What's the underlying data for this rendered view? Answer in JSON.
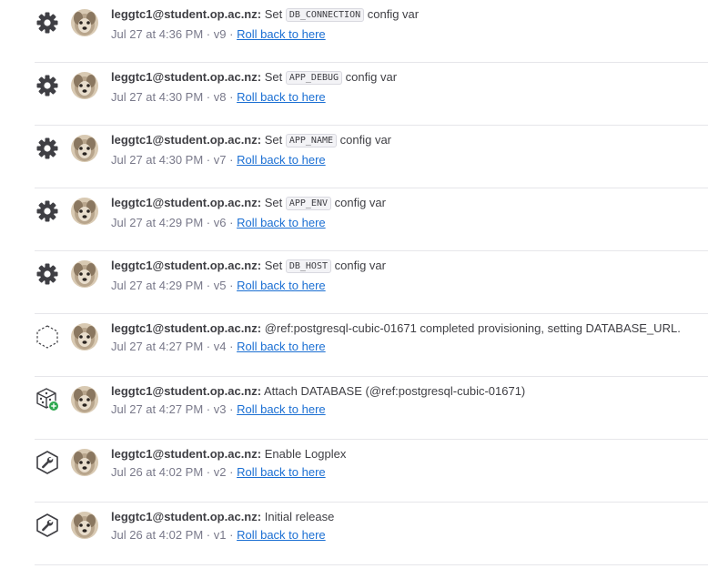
{
  "activity": [
    {
      "icon": "gear-icon",
      "user": "leggtc1@student.op.ac.nz:",
      "pre": "Set",
      "code": "DB_CONNECTION",
      "post": "config var",
      "time": "Jul 27 at 4:36 PM",
      "version": "v9",
      "rollback": "Roll back to here"
    },
    {
      "icon": "gear-icon",
      "user": "leggtc1@student.op.ac.nz:",
      "pre": "Set",
      "code": "APP_DEBUG",
      "post": "config var",
      "time": "Jul 27 at 4:30 PM",
      "version": "v8",
      "rollback": "Roll back to here"
    },
    {
      "icon": "gear-icon",
      "user": "leggtc1@student.op.ac.nz:",
      "pre": "Set",
      "code": "APP_NAME",
      "post": "config var",
      "time": "Jul 27 at 4:30 PM",
      "version": "v7",
      "rollback": "Roll back to here"
    },
    {
      "icon": "gear-icon",
      "user": "leggtc1@student.op.ac.nz:",
      "pre": "Set",
      "code": "APP_ENV",
      "post": "config var",
      "time": "Jul 27 at 4:29 PM",
      "version": "v6",
      "rollback": "Roll back to here"
    },
    {
      "icon": "gear-icon",
      "user": "leggtc1@student.op.ac.nz:",
      "pre": "Set",
      "code": "DB_HOST",
      "post": "config var",
      "time": "Jul 27 at 4:29 PM",
      "version": "v5",
      "rollback": "Roll back to here"
    },
    {
      "icon": "dashed-hexagon-icon",
      "user": "leggtc1@student.op.ac.nz:",
      "pre": "@ref:postgresql-cubic-01671 completed provisioning, setting DATABASE_URL.",
      "code": "",
      "post": "",
      "time": "Jul 27 at 4:27 PM",
      "version": "v4",
      "rollback": "Roll back to here"
    },
    {
      "icon": "addon-cube-icon",
      "user": "leggtc1@student.op.ac.nz:",
      "pre": "Attach DATABASE (@ref:postgresql-cubic-01671)",
      "code": "",
      "post": "",
      "time": "Jul 27 at 4:27 PM",
      "version": "v3",
      "rollback": "Roll back to here"
    },
    {
      "icon": "wrench-hexagon-icon",
      "user": "leggtc1@student.op.ac.nz:",
      "pre": "Enable Logplex",
      "code": "",
      "post": "",
      "time": "Jul 26 at 4:02 PM",
      "version": "v2",
      "rollback": "Roll back to here"
    },
    {
      "icon": "wrench-hexagon-icon",
      "user": "leggtc1@student.op.ac.nz:",
      "pre": "Initial release",
      "code": "",
      "post": "",
      "time": "Jul 26 at 4:02 PM",
      "version": "v1",
      "rollback": "Roll back to here"
    }
  ],
  "colors": {
    "link": "#1b6fd3",
    "icon": "#3f3f44",
    "addon_badge": "#2fa84f",
    "text": "#3f3f44",
    "muted": "#79798a"
  }
}
